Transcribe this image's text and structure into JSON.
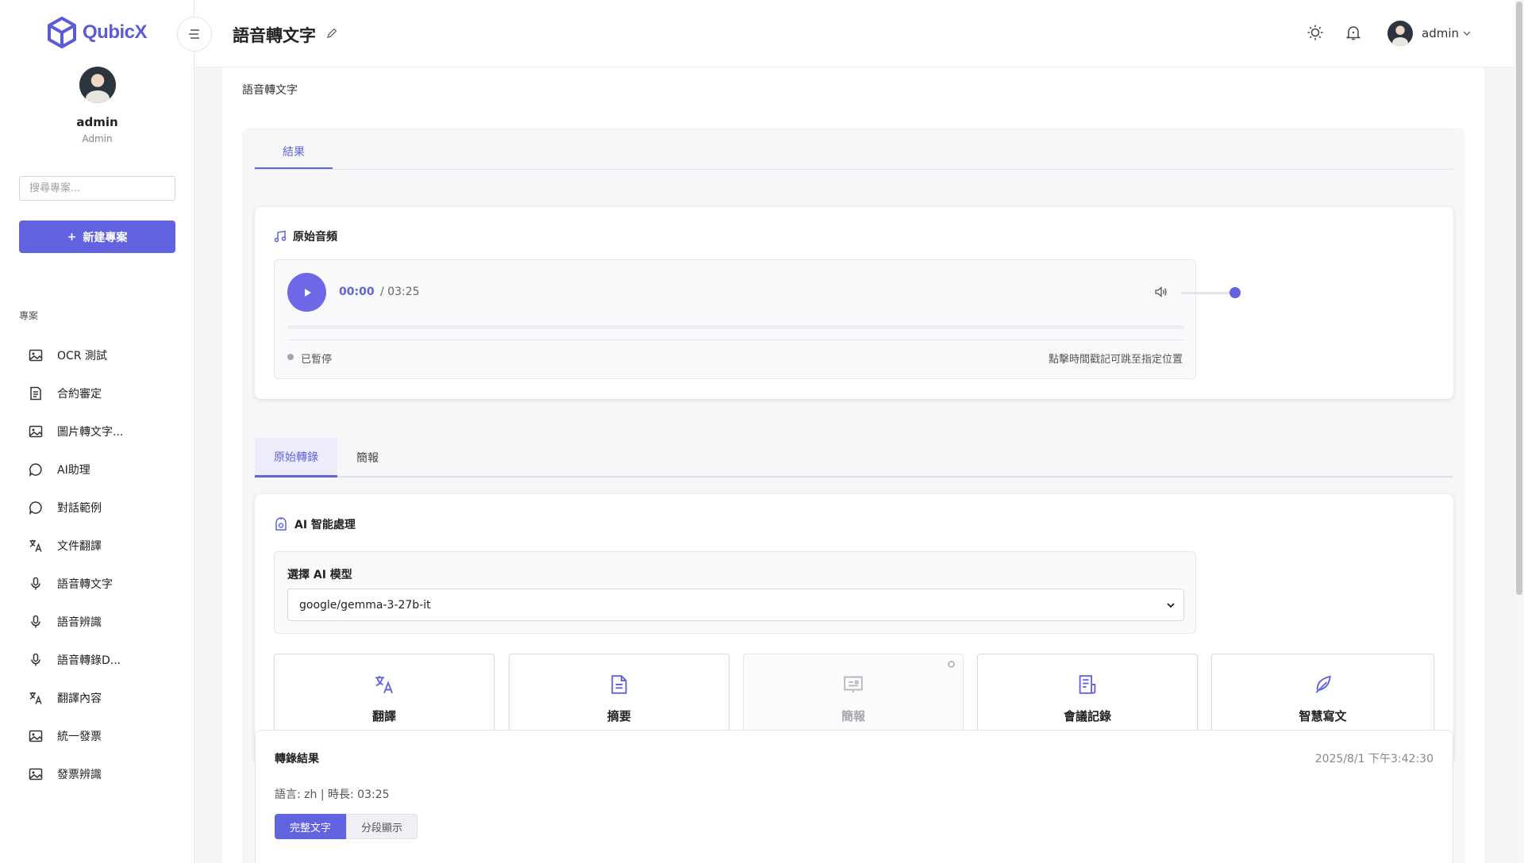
{
  "app": {
    "logo_text": "QubicX",
    "accent_color": "#6263e0"
  },
  "sidebar": {
    "user_name": "admin",
    "user_role": "Admin",
    "search_placeholder": "搜尋專案...",
    "new_project_label": "新建專案",
    "section_label": "專案",
    "items": [
      {
        "label": "OCR 測試",
        "icon": "image-icon"
      },
      {
        "label": "合約審定",
        "icon": "document-icon"
      },
      {
        "label": "圖片轉文字...",
        "icon": "image-icon"
      },
      {
        "label": "AI助理",
        "icon": "chat-icon"
      },
      {
        "label": "對話範例",
        "icon": "chat-icon"
      },
      {
        "label": "文件翻譯",
        "icon": "translate-icon"
      },
      {
        "label": "語音轉文字",
        "icon": "microphone-icon"
      },
      {
        "label": "語音辨識",
        "icon": "microphone-icon"
      },
      {
        "label": "語音轉錄D...",
        "icon": "microphone-icon"
      },
      {
        "label": "翻譯內容",
        "icon": "translate-icon"
      },
      {
        "label": "統一發票",
        "icon": "image-icon"
      },
      {
        "label": "發票辨識",
        "icon": "image-icon"
      }
    ]
  },
  "header": {
    "title": "語音轉文字",
    "user_name": "admin"
  },
  "main": {
    "breadcrumb": "語音轉文字",
    "result_tab": "結果",
    "audio_card": {
      "title": "原始音頻",
      "current_time": "00:00",
      "total_time": "/ 03:25",
      "progress": 0,
      "volume": 1.0,
      "status": "已暫停",
      "hint": "點擊時間戳記可跳至指定位置"
    },
    "subtabs": [
      "原始轉錄",
      "簡報"
    ],
    "ai_card": {
      "title": "AI 智能處理",
      "model_label": "選擇 AI 模型",
      "model_value": "google/gemma-3-27b-it",
      "tools": [
        {
          "label": "翻譯",
          "icon": "translate-icon",
          "enabled": true
        },
        {
          "label": "摘要",
          "icon": "document-icon",
          "enabled": true
        },
        {
          "label": "簡報",
          "icon": "presentation-icon",
          "enabled": false
        },
        {
          "label": "會議記錄",
          "icon": "notes-icon",
          "enabled": true
        },
        {
          "label": "智慧寫文",
          "icon": "feather-icon",
          "enabled": true
        }
      ]
    },
    "result": {
      "title": "轉錄結果",
      "timestamp": "2025/8/1 下午3:42:30",
      "meta": "語言: zh | 時長: 03:25",
      "view_buttons": [
        "完整文字",
        "分段顯示"
      ]
    }
  }
}
